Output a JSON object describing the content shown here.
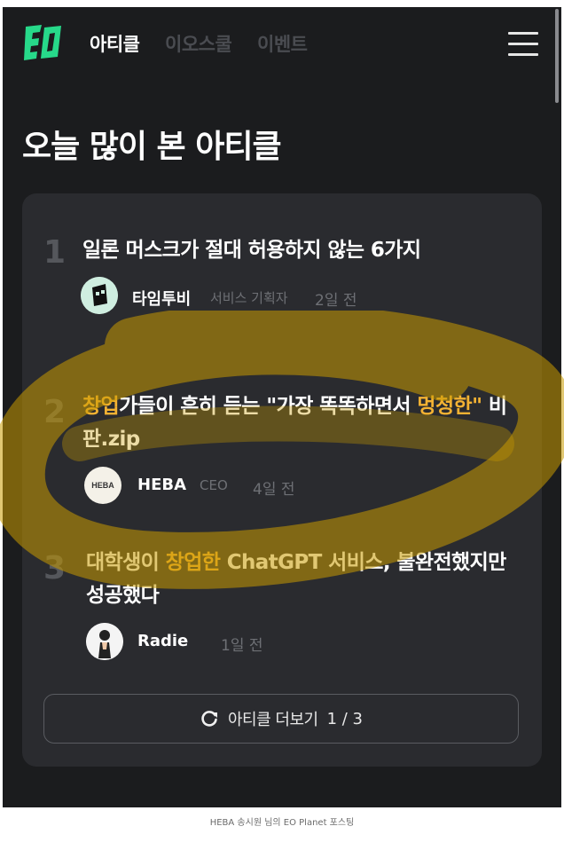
{
  "nav": {
    "tabs": [
      {
        "label": "아티클",
        "active": true
      },
      {
        "label": "이오스쿨",
        "active": false
      },
      {
        "label": "이벤트",
        "active": false
      }
    ],
    "logo_icon": "eo-logo",
    "menu_icon": "hamburger-menu-icon"
  },
  "section": {
    "title": "오늘 많이 본 아티클"
  },
  "articles": [
    {
      "rank": "1",
      "title": "일론 머스크가 절대 허용하지 않는 6가지",
      "author": "타임투비",
      "role": "서비스 기획자",
      "time": "2일 전"
    },
    {
      "rank": "2",
      "title_parts": [
        "창업",
        "가들이 흔히 듣는 \"가장 똑똑하면서 ",
        "멍청한\"",
        " 비판.zip"
      ],
      "author": "HEBA",
      "avatar_text": "HEBA",
      "role": "CEO",
      "time": "4일 전"
    },
    {
      "rank": "3",
      "title_parts": [
        "대학생이 ",
        "창업한",
        " ChatGPT 서비스, 불완전했지만 성공했다"
      ],
      "author": "Radie",
      "role": "",
      "time": "1일 전"
    }
  ],
  "more_button": {
    "label": "아티클 더보기",
    "page": "1 / 3",
    "icon": "refresh-icon"
  },
  "caption": "HEBA 송시원 님의 EO Planet 포스팅",
  "colors": {
    "background": "#1b1c1e",
    "card": "#2a2b2f",
    "highlight": "#f3b233",
    "logo": "#27d98a"
  }
}
